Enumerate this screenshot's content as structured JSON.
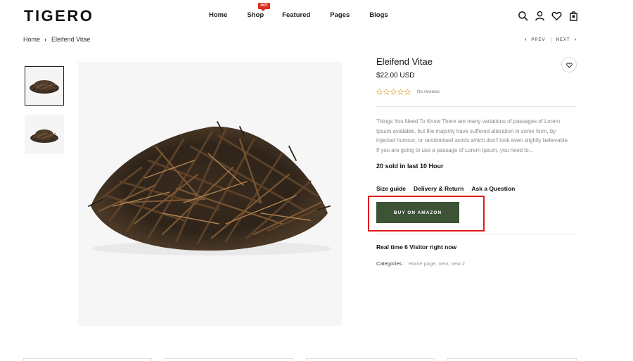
{
  "header": {
    "logo": "TIGERO",
    "nav": [
      {
        "label": "Home"
      },
      {
        "label": "Shop",
        "badge": "HOT"
      },
      {
        "label": "Featured"
      },
      {
        "label": "Pages"
      },
      {
        "label": "Blogs"
      }
    ],
    "icons": [
      "search-icon",
      "user-icon",
      "heart-icon",
      "bag-icon"
    ]
  },
  "breadcrumb": {
    "home": "Home",
    "current": "Eleifend Vitae"
  },
  "pager": {
    "prev": "PREV",
    "next": "NEXT"
  },
  "product": {
    "title": "Eleifend Vitae",
    "price": "$22.00 USD",
    "rating": 0,
    "reviews_label": "No reviews",
    "description": "Things You Need To Know There are many variations of passages of Lorem Ipsum available, but the majority have suffered alteration in some form, by injected humour, or randomised words which don't look even slightly believable. If you are going to use a passage of Lorem Ipsum, you need to...",
    "sold_text": "20 sold in last 10 Hour",
    "links": {
      "size_guide": "Size guide",
      "delivery": "Delivery & Return",
      "ask": "Ask a Question"
    },
    "buy_button": "BUY ON AMAZON",
    "visitors_text": "Real time 6 Visitor right now",
    "categories_label": "Categories :",
    "categories_values": "Home page, new, new 2"
  },
  "colors": {
    "accent_button": "#3c5336",
    "hot_badge": "#e02b1b",
    "highlight": "#e21a1a",
    "star": "#e3a23a"
  }
}
